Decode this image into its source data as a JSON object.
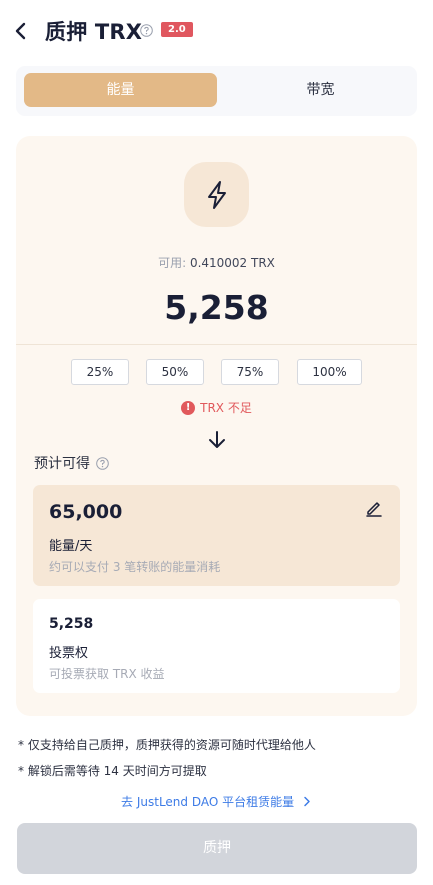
{
  "header": {
    "title": "质押 TRX",
    "version_badge": "2.0"
  },
  "tabs": [
    {
      "label": "能量",
      "active": true
    },
    {
      "label": "带宽",
      "active": false
    }
  ],
  "card": {
    "available_label": "可用: ",
    "available_value": "0.410002 TRX",
    "amount": "5,258",
    "percent_options": [
      "25%",
      "50%",
      "75%",
      "100%"
    ],
    "warning": "TRX 不足",
    "estimate_label": "预计可得",
    "energy": {
      "value": "65,000",
      "unit": "能量/天",
      "hint": "约可以支付 3 笔转账的能量消耗"
    },
    "votes": {
      "value": "5,258",
      "unit": "投票权",
      "hint": "可投票获取 TRX 收益"
    }
  },
  "notes": [
    "* 仅支持给自己质押，质押获得的资源可随时代理给他人",
    "* 解锁后需等待 14 天时间方可提取"
  ],
  "link_text": "去 JustLend DAO 平台租赁能量",
  "submit_label": "质押",
  "colors": {
    "accent": "#e3b987",
    "warning": "#e1595c",
    "link": "#3d7be6",
    "disabled_button": "#d2d5db"
  }
}
